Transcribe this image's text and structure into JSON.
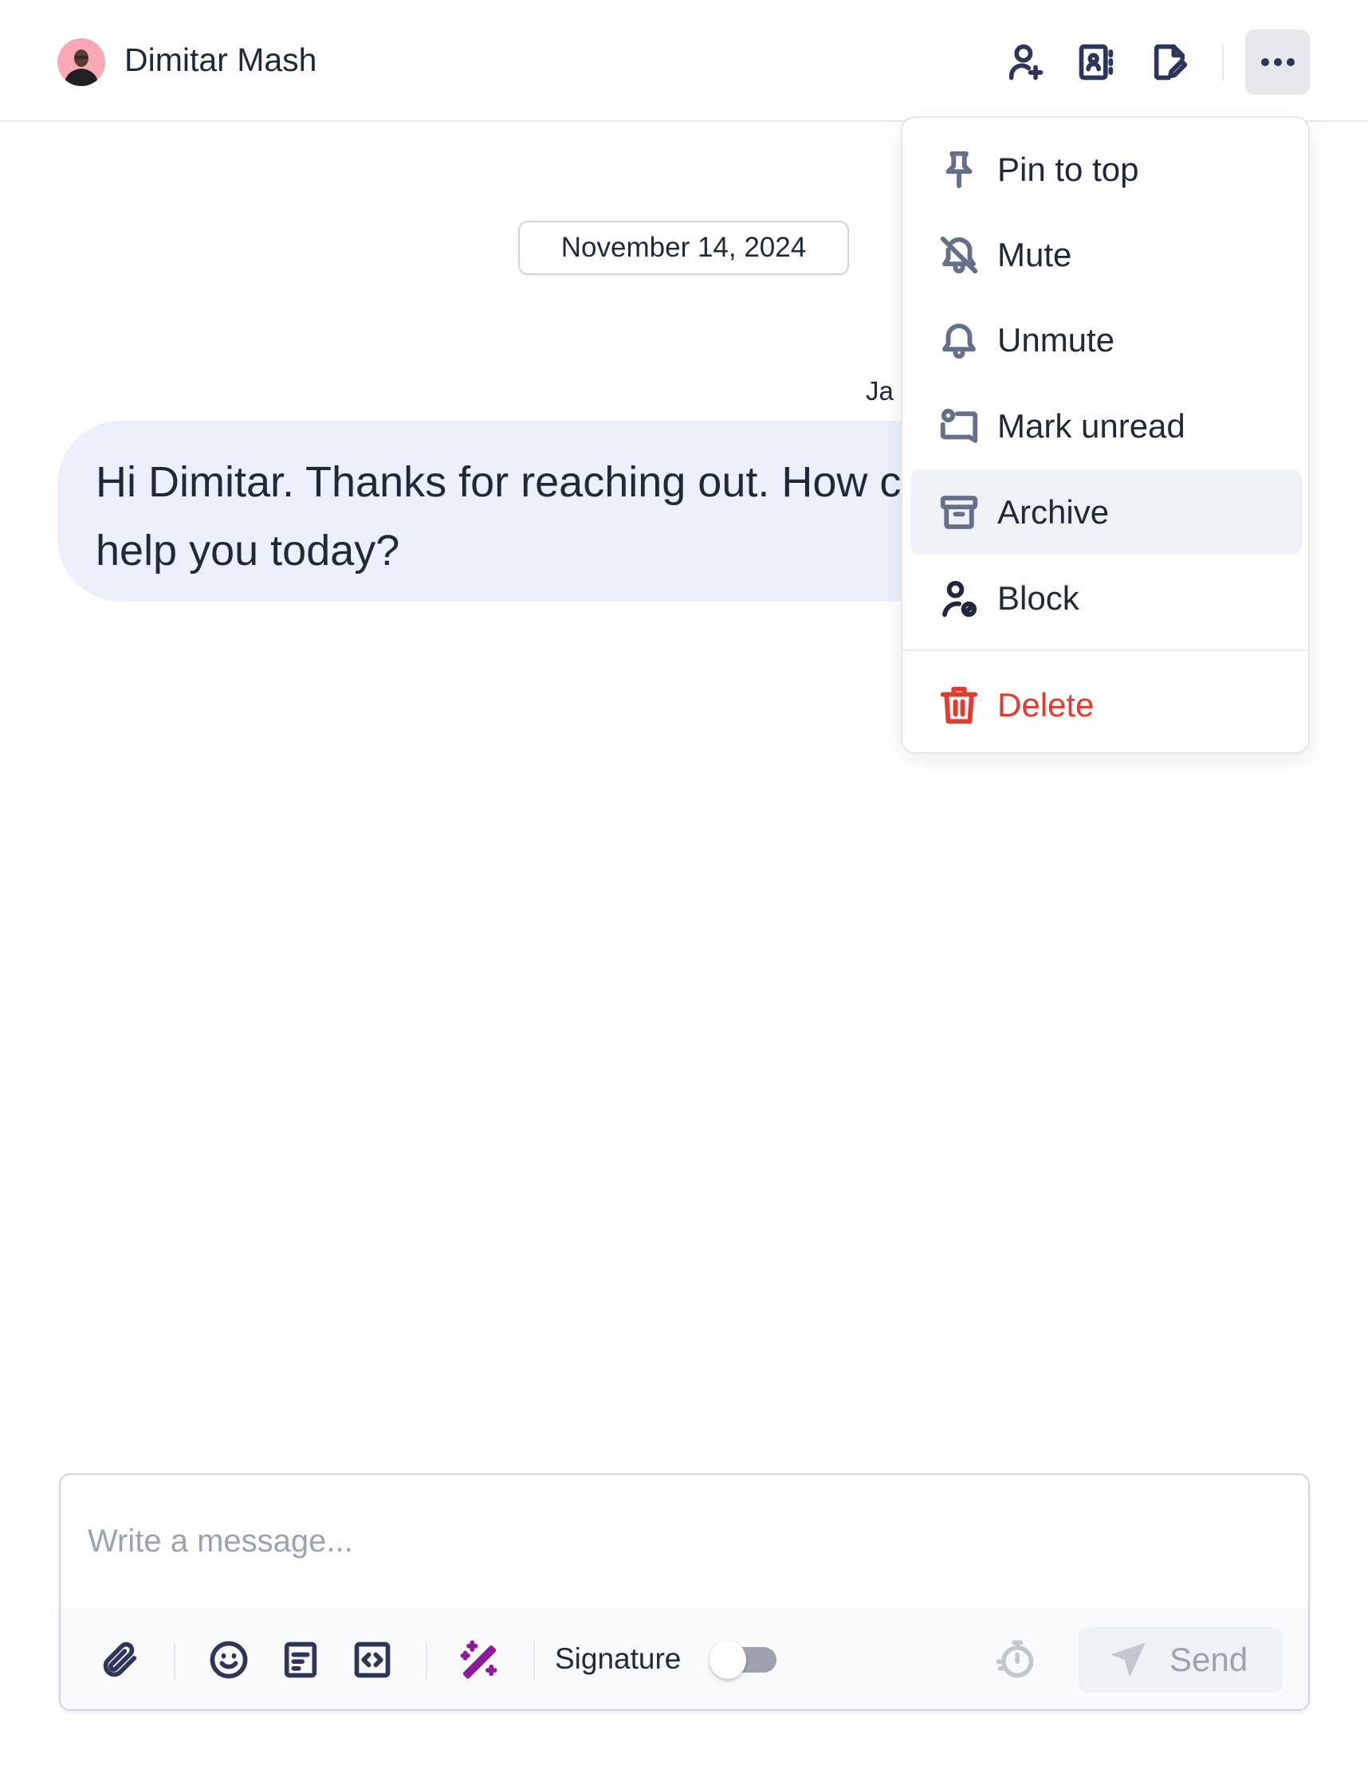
{
  "header": {
    "contact_name": "Dimitar Mash",
    "icons": [
      "user-plus-icon",
      "contact-card-icon",
      "edit-note-icon",
      "more-horizontal-icon"
    ]
  },
  "conversation": {
    "date": "November 14, 2024",
    "sender": "Ja",
    "message_lines": [
      "Hi Dimitar. Thanks for reaching out. How can I",
      "help you today?"
    ]
  },
  "menu": {
    "items": [
      {
        "label": "Pin to top",
        "icon": "pin-icon"
      },
      {
        "label": "Mute",
        "icon": "bell-off-icon"
      },
      {
        "label": "Unmute",
        "icon": "bell-icon"
      },
      {
        "label": "Mark unread",
        "icon": "message-unread-icon"
      },
      {
        "label": "Archive",
        "icon": "archive-icon",
        "highlighted": true
      },
      {
        "label": "Block",
        "icon": "user-block-icon"
      },
      {
        "label": "Delete",
        "icon": "trash-icon",
        "color": "#e43b2e"
      }
    ]
  },
  "composer": {
    "placeholder": "Write a message...",
    "signature_label": "Signature",
    "signature_on": false,
    "send_label": "Send",
    "ai_color": "#8e1a9b"
  }
}
